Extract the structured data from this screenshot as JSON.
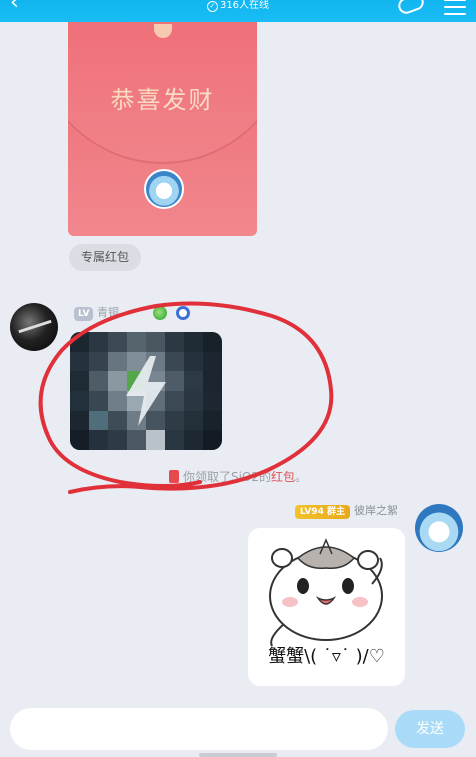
{
  "header": {
    "online_count": "316人在线",
    "back_icon": "chevron-left-icon",
    "menu_icon": "menu-icon"
  },
  "red_packet": {
    "greeting": "恭喜发财",
    "type_label": "专属红包",
    "color": "#ef6b74"
  },
  "messages": {
    "left_sender": {
      "level": "LV",
      "title": "青铜"
    },
    "notice": {
      "prefix": "你领取了",
      "sender": "SiO2",
      "suffix": "的",
      "highlight": "红包",
      "end": "。"
    },
    "right_sender": {
      "level": "LV94",
      "role": "群主",
      "name": "彼岸之絮"
    },
    "sticker_caption": "蟹蟹\\( ˙▿˙ )/♡"
  },
  "input": {
    "placeholder": ""
  },
  "send_label": "发送",
  "colors": {
    "header": "#12b5f0",
    "annotation": "#e0303a",
    "send": "#a9dbf8"
  }
}
